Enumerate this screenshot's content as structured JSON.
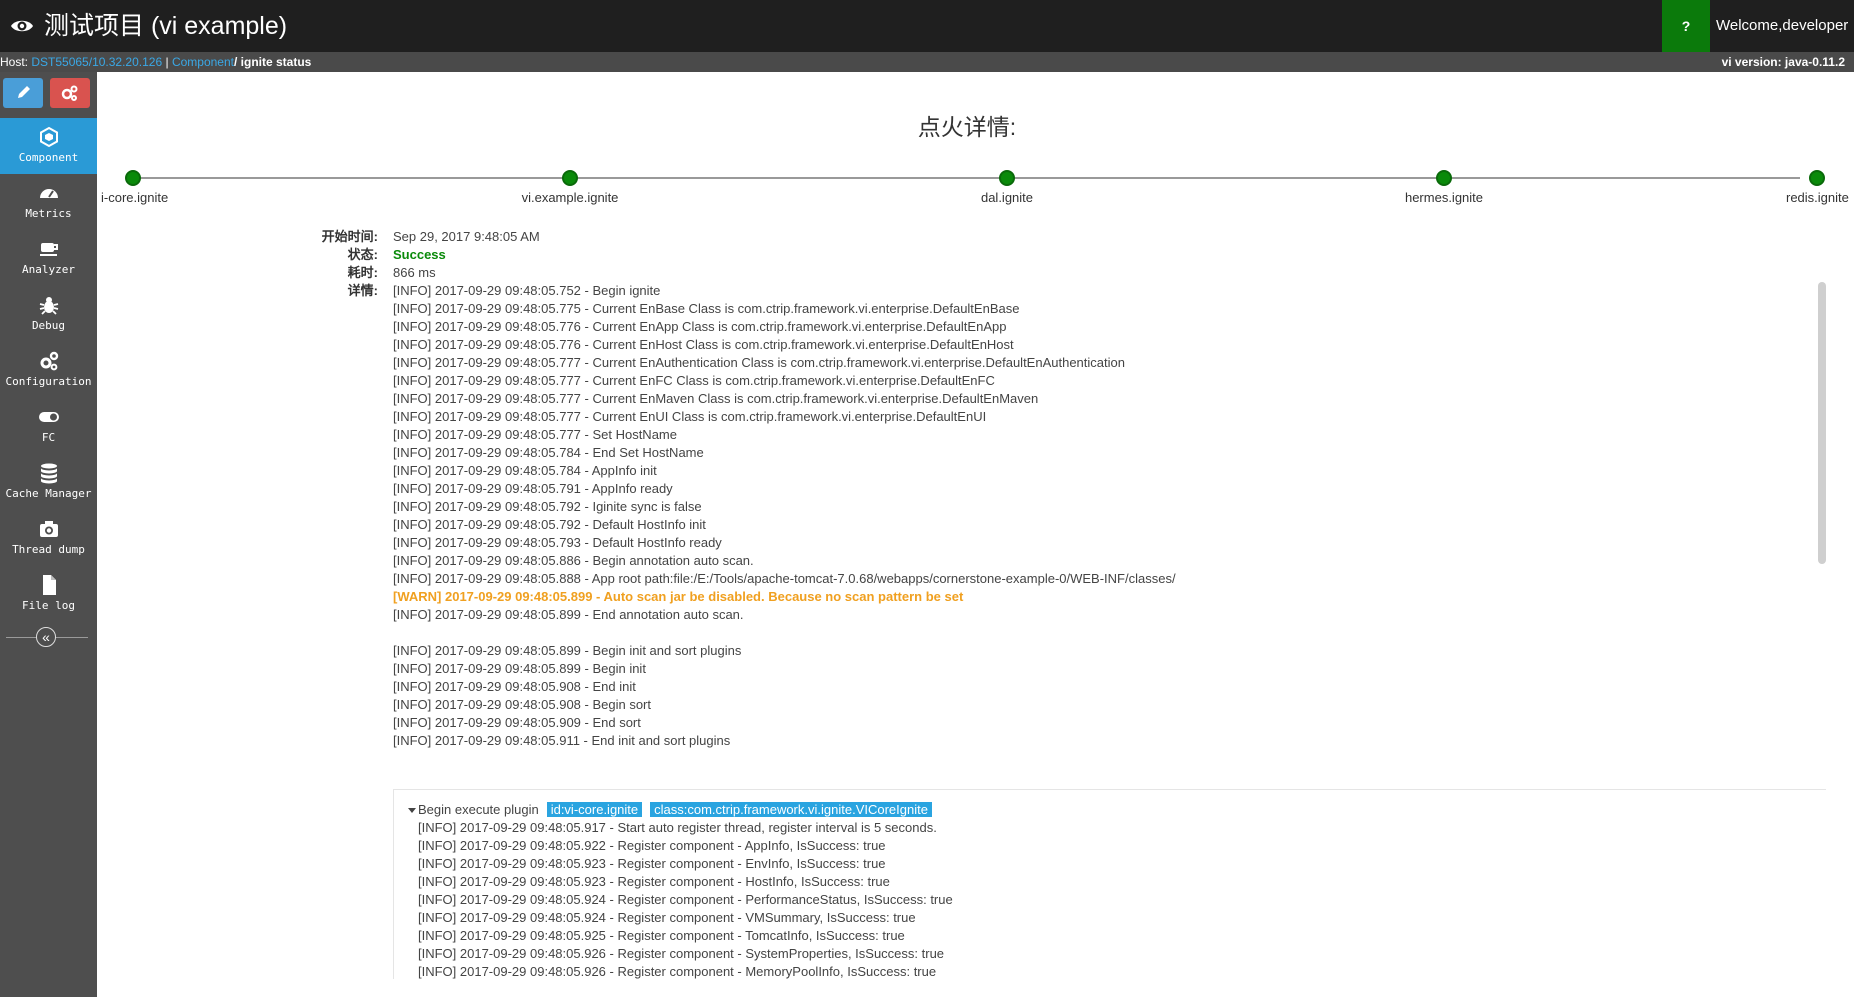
{
  "header": {
    "title": "测试项目 (vi example)",
    "help_label": "?",
    "welcome_label": "Welcome,developer"
  },
  "subbar": {
    "host_prefix": "Host:",
    "host_link": "DST55065/10.32.20.126",
    "separator": "|",
    "component_link": "Component",
    "current_page": "/ ignite status",
    "version": "vi version: java-0.11.2"
  },
  "sidebar": {
    "items": [
      {
        "label": "Component",
        "icon": "component-icon"
      },
      {
        "label": "Metrics",
        "icon": "dashboard-icon"
      },
      {
        "label": "Analyzer",
        "icon": "coffee-icon"
      },
      {
        "label": "Debug",
        "icon": "bug-icon"
      },
      {
        "label": "Configuration",
        "icon": "gears-icon"
      },
      {
        "label": "FC",
        "icon": "toggle-icon"
      },
      {
        "label": "Cache Manager",
        "icon": "database-icon"
      },
      {
        "label": "Thread dump",
        "icon": "camera-icon"
      },
      {
        "label": "File log",
        "icon": "file-icon"
      }
    ],
    "collapse_glyph": "«"
  },
  "main": {
    "title": "点火详情:",
    "timeline": [
      "i-core.ignite",
      "vi.example.ignite",
      "dal.ignite",
      "hermes.ignite",
      "redis.ignite"
    ],
    "info": {
      "start_label": "开始时间:",
      "start_value": "Sep 29, 2017 9:48:05 AM",
      "status_label": "状态:",
      "status_value": "Success",
      "duration_label": "耗时:",
      "duration_value": "866 ms",
      "detail_label": "详情:",
      "detail_first": "[INFO] 2017-09-29 09:48:05.752 - Begin ignite"
    },
    "log": [
      "",
      "[INFO] 2017-09-29 09:48:05.775 - Current EnBase Class is com.ctrip.framework.vi.enterprise.DefaultEnBase",
      "[INFO] 2017-09-29 09:48:05.776 - Current EnApp Class is com.ctrip.framework.vi.enterprise.DefaultEnApp",
      "[INFO] 2017-09-29 09:48:05.776 - Current EnHost Class is com.ctrip.framework.vi.enterprise.DefaultEnHost",
      "[INFO] 2017-09-29 09:48:05.777 - Current EnAuthentication Class is com.ctrip.framework.vi.enterprise.DefaultEnAuthentication",
      "[INFO] 2017-09-29 09:48:05.777 - Current EnFC Class is com.ctrip.framework.vi.enterprise.DefaultEnFC",
      "[INFO] 2017-09-29 09:48:05.777 - Current EnMaven Class is com.ctrip.framework.vi.enterprise.DefaultEnMaven",
      "[INFO] 2017-09-29 09:48:05.777 - Current EnUI Class is com.ctrip.framework.vi.enterprise.DefaultEnUI",
      "[INFO] 2017-09-29 09:48:05.777 - Set HostName",
      "[INFO] 2017-09-29 09:48:05.784 - End Set HostName",
      "[INFO] 2017-09-29 09:48:05.784 - AppInfo init",
      "[INFO] 2017-09-29 09:48:05.791 - AppInfo ready",
      "[INFO] 2017-09-29 09:48:05.792 - Iginite sync is false",
      "[INFO] 2017-09-29 09:48:05.792 - Default HostInfo init",
      "[INFO] 2017-09-29 09:48:05.793 - Default HostInfo ready",
      "[INFO] 2017-09-29 09:48:05.886 - Begin annotation auto scan.",
      "[INFO] 2017-09-29 09:48:05.888 - App root path:file:/E:/Tools/apache-tomcat-7.0.68/webapps/cornerstone-example-0/WEB-INF/classes/",
      "[WARN] 2017-09-29 09:48:05.899 - Auto scan jar be disabled. Because no scan pattern be set",
      "[INFO] 2017-09-29 09:48:05.899 - End annotation auto scan.",
      "",
      "[INFO] 2017-09-29 09:48:05.899 - Begin init and sort plugins",
      "[INFO] 2017-09-29 09:48:05.899 - Begin init",
      "[INFO] 2017-09-29 09:48:05.908 - End init",
      "[INFO] 2017-09-29 09:48:05.908 - Begin sort",
      "[INFO] 2017-09-29 09:48:05.909 - End sort",
      "[INFO] 2017-09-29 09:48:05.911 - End init and sort plugins"
    ],
    "plugin": {
      "head": "Begin execute plugin",
      "id_tag": "id:vi-core.ignite",
      "class_tag": "class:com.ctrip.framework.vi.ignite.VICoreIgnite",
      "log": [
        "[INFO] 2017-09-29 09:48:05.917 - Start auto register thread, register interval is 5 seconds.",
        "[INFO] 2017-09-29 09:48:05.922 - Register component - AppInfo, IsSuccess: true",
        "[INFO] 2017-09-29 09:48:05.923 - Register component - EnvInfo, IsSuccess: true",
        "[INFO] 2017-09-29 09:48:05.923 - Register component - HostInfo, IsSuccess: true",
        "[INFO] 2017-09-29 09:48:05.924 - Register component - PerformanceStatus, IsSuccess: true",
        "[INFO] 2017-09-29 09:48:05.924 - Register component - VMSummary, IsSuccess: true",
        "[INFO] 2017-09-29 09:48:05.925 - Register component - TomcatInfo, IsSuccess: true",
        "[INFO] 2017-09-29 09:48:05.926 - Register component - SystemProperties, IsSuccess: true",
        "[INFO] 2017-09-29 09:48:05.926 - Register component - MemoryPoolInfo, IsSuccess: true"
      ]
    }
  },
  "colors": {
    "topbar": "#1f1f1f",
    "sidebar": "#4e4e4e",
    "accent": "#2a9ad6",
    "success": "#0a8a0a",
    "warn": "#f0a020",
    "danger": "#d9534f"
  }
}
